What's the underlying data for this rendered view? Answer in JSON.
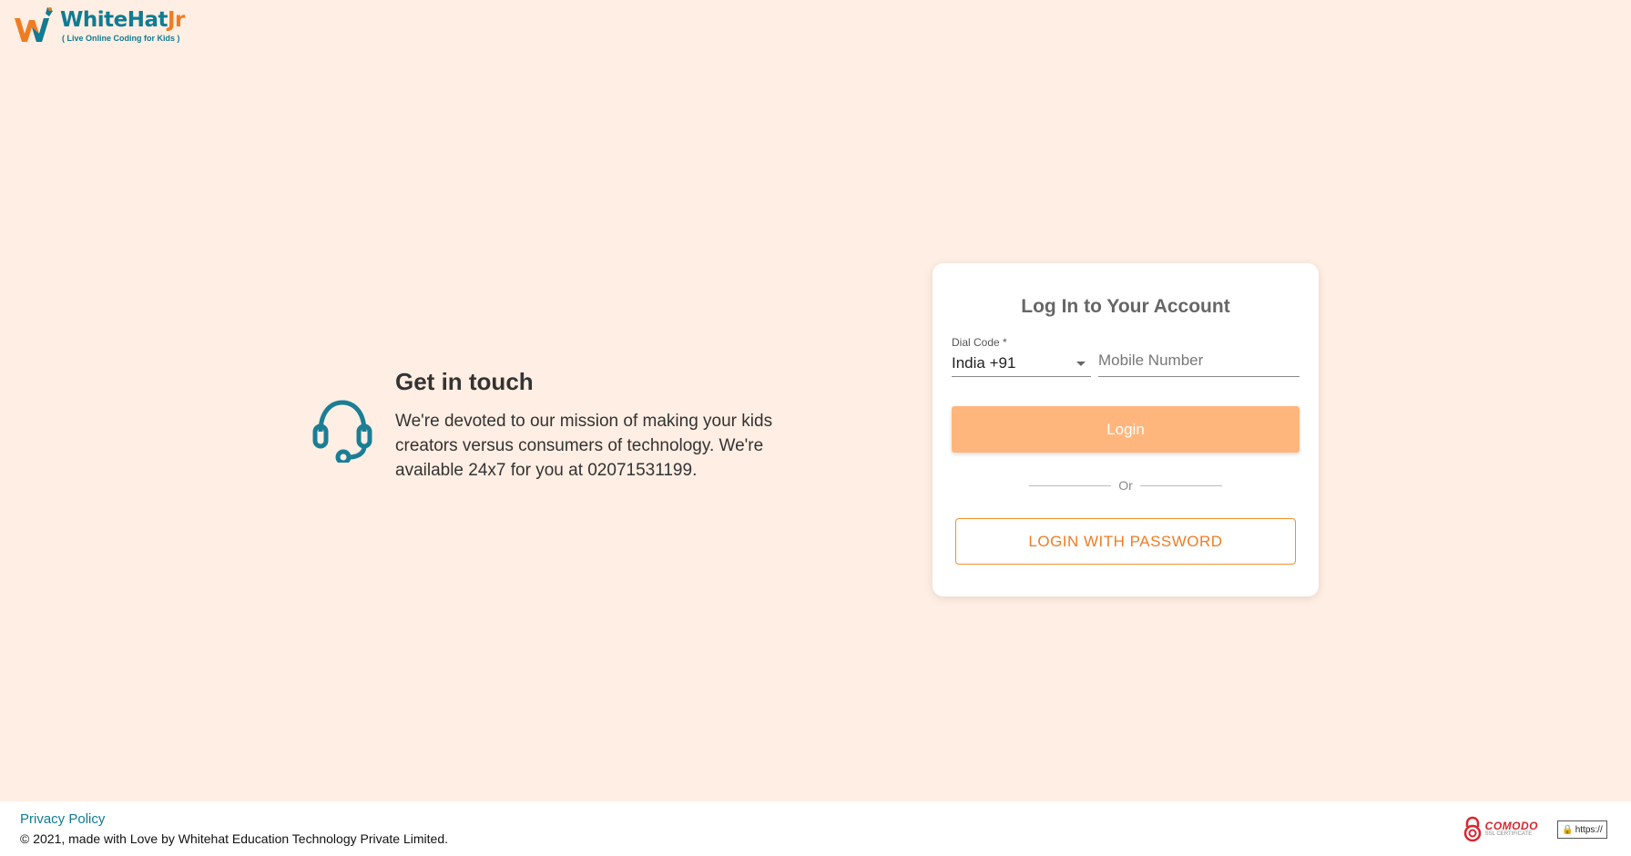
{
  "brand": {
    "name_main": "WhiteHat",
    "name_suffix": "Jr",
    "tagline": "( Live Online Coding for Kids )",
    "primary_color": "#0f7c93",
    "accent_color": "#f07c22"
  },
  "contact": {
    "icon": "headset-icon",
    "title": "Get in touch",
    "body": "We're devoted to our mission of making your kids creators versus consumers of technology. We're available 24x7 for you at 02071531199."
  },
  "login_card": {
    "title": "Log In to Your Account",
    "dial_code_label": "Dial Code *",
    "dial_code_value": "India +91",
    "mobile_placeholder": "Mobile Number",
    "login_button": "Login",
    "divider_text": "Or",
    "password_button": "LOGIN WITH PASSWORD",
    "login_button_color": "#ffb67c"
  },
  "footer": {
    "privacy_link": "Privacy Policy",
    "copyright": "© 2021, made with Love by Whitehat Education Technology Private Limited.",
    "comodo_name": "COMODO",
    "comodo_sub": "SSL CERTIFICATE",
    "https_badge": "https://"
  },
  "background_color": "#ffeee3"
}
